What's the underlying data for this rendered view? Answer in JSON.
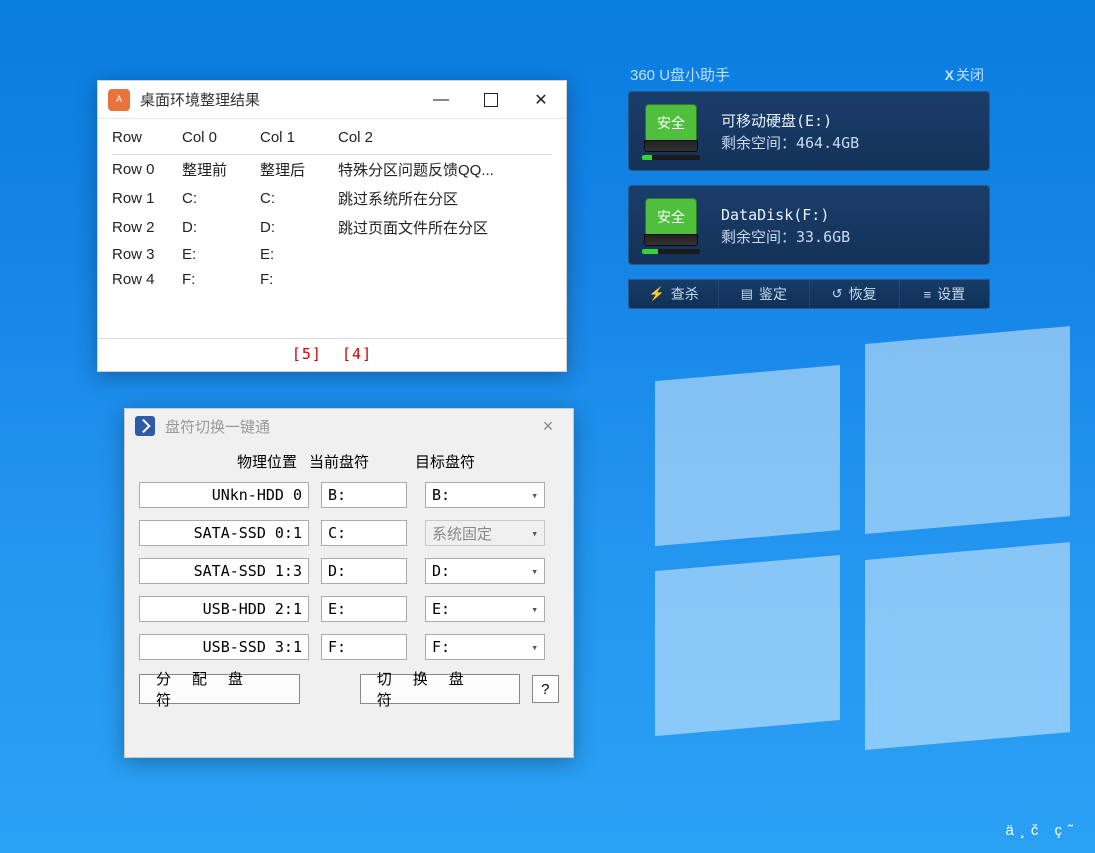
{
  "win1": {
    "title": "桌面环境整理结果",
    "headers": [
      "Row",
      "Col 0",
      "Col 1",
      "Col 2"
    ],
    "rows": [
      {
        "label": "Row 0",
        "c0": "整理前",
        "c1": "整理后",
        "c2": "特殊分区问题反馈QQ..."
      },
      {
        "label": "Row 1",
        "c0": "C:",
        "c1": "C:",
        "c2": "跳过系统所在分区"
      },
      {
        "label": "Row 2",
        "c0": "D:",
        "c1": "D:",
        "c2": "跳过页面文件所在分区"
      },
      {
        "label": "Row 3",
        "c0": "E:",
        "c1": "E:",
        "c2": ""
      },
      {
        "label": "Row 4",
        "c0": "F:",
        "c1": "F:",
        "c2": ""
      }
    ],
    "footer_a": "[5]",
    "footer_b": "[4]"
  },
  "win2": {
    "title": "盘符切换一键通",
    "col1": "物理位置",
    "col2": "当前盘符",
    "col3": "目标盘符",
    "rows": [
      {
        "loc": "UNkn-HDD 0",
        "cur": "B:",
        "tgt": "B:",
        "disabled": false
      },
      {
        "loc": "SATA-SSD 0:1",
        "cur": "C:",
        "tgt": "系统固定",
        "disabled": true
      },
      {
        "loc": "SATA-SSD 1:3",
        "cur": "D:",
        "tgt": "D:",
        "disabled": false
      },
      {
        "loc": "USB-HDD 2:1",
        "cur": "E:",
        "tgt": "E:",
        "disabled": false
      },
      {
        "loc": "USB-SSD 3:1",
        "cur": "F:",
        "tgt": "F:",
        "disabled": false
      }
    ],
    "btn_assign": "分 配 盘 符",
    "btn_switch": "切 换 盘 符",
    "btn_help": "?"
  },
  "usb": {
    "title": "360 U盘小助手",
    "close": "关闭",
    "badge": "安全",
    "disks": [
      {
        "name": "可移动硬盘(E:)",
        "space_label": "剩余空间：",
        "space": "464.4GB",
        "fill": 18
      },
      {
        "name": "DataDisk(F:)",
        "space_label": "剩余空间：",
        "space": "33.6GB",
        "fill": 28
      }
    ],
    "toolbar": [
      {
        "icon": "⚡",
        "label": "查杀"
      },
      {
        "icon": "▤",
        "label": "鉴定"
      },
      {
        "icon": "↺",
        "label": "恢复"
      },
      {
        "icon": "≡",
        "label": "设置"
      }
    ]
  },
  "corner": "ä¸č ç˜"
}
